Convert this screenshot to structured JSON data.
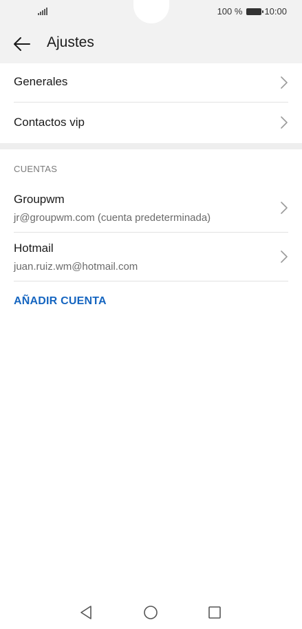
{
  "status_bar": {
    "battery_text": "100 %",
    "time": "10:00"
  },
  "header": {
    "title": "Ajustes"
  },
  "general_items": [
    {
      "label": "Generales"
    },
    {
      "label": "Contactos vip"
    }
  ],
  "accounts_section": {
    "label": "CUENTAS",
    "accounts": [
      {
        "name": "Groupwm",
        "detail": "jr@groupwm.com (cuenta predeterminada)"
      },
      {
        "name": "Hotmail",
        "detail": "juan.ruiz.wm@hotmail.com"
      }
    ],
    "add_label": "AÑADIR CUENTA"
  },
  "colors": {
    "accent": "#1565c0",
    "header_bg": "#f2f2f2"
  },
  "icons": {
    "back": "arrow-left-icon",
    "chevron": "chevron-right-icon",
    "nav_back": "triangle-back-icon",
    "nav_home": "circle-home-icon",
    "nav_recents": "square-recents-icon"
  }
}
